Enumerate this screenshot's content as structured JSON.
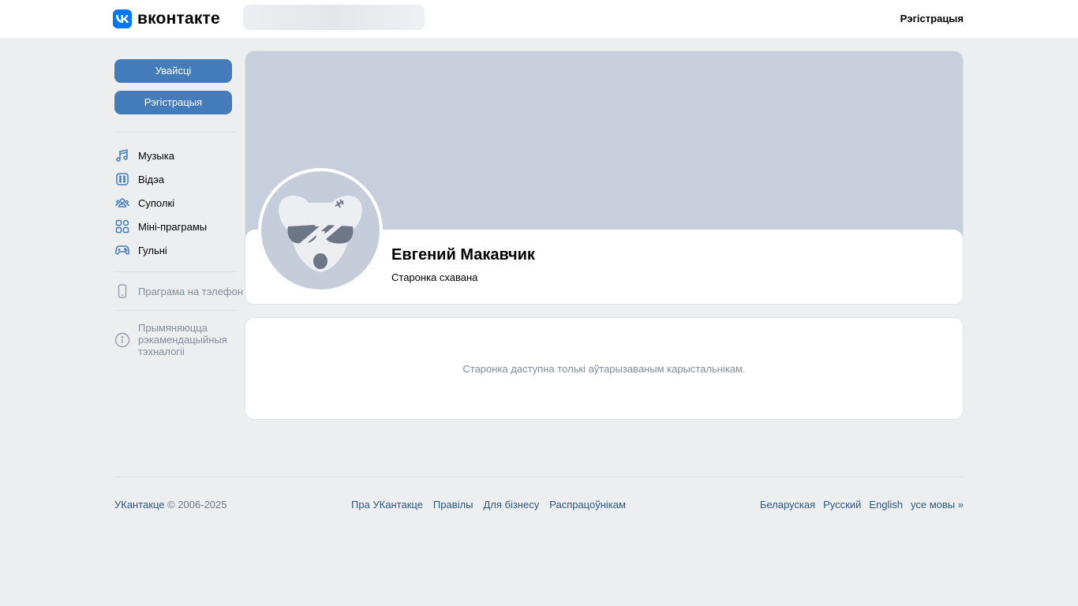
{
  "header": {
    "logo_text": "вконтакте",
    "register_label": "Рэгістрацыя"
  },
  "sidebar": {
    "login_label": "Увайсці",
    "register_label": "Рэгістрацыя",
    "items": [
      {
        "label": "Музыка",
        "icon": "music-note-icon"
      },
      {
        "label": "Відэа",
        "icon": "video-icon"
      },
      {
        "label": "Суполкі",
        "icon": "users-icon"
      },
      {
        "label": "Міні-праграмы",
        "icon": "apps-grid-icon"
      },
      {
        "label": "Гульні",
        "icon": "gamepad-icon"
      }
    ],
    "phone_app_label": "Праграма на тэлефон",
    "recommendation_text": [
      "Прымяняюцца",
      "рэкамендацыйныя",
      "тэхналогіі"
    ]
  },
  "profile": {
    "name": "Евгений Макавчик",
    "status": "Старонка схавана"
  },
  "notice": {
    "text": "Старонка даступна толькі аўтарызаваным карыстальнікам."
  },
  "footer": {
    "brand": "УКантакце",
    "copyright": "© 2006-2025",
    "links": [
      "Пра УКантакце",
      "Правілы",
      "Для бізнесу",
      "Распрацоўнікам"
    ],
    "languages": [
      "Беларуская",
      "Русский",
      "English",
      "усе мовы »"
    ]
  },
  "colors": {
    "accent": "#447bba",
    "brand": "#0077ff",
    "background": "#edeef0",
    "cover": "#c8cfdc",
    "link": "#2a5885",
    "muted": "#818c99"
  }
}
